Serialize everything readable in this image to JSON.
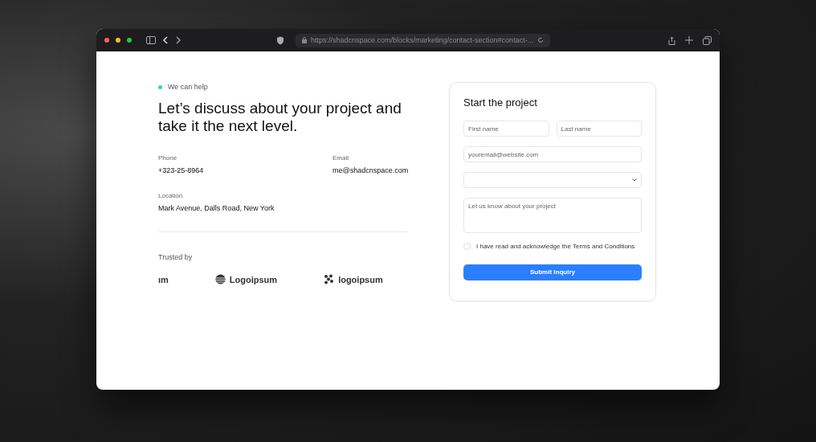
{
  "browser": {
    "url": "https://shadcnspace.com/blocks/marketing/contact-section#contact-..."
  },
  "badge": {
    "label": "We can help",
    "color": "#2dd4bf"
  },
  "heading": "Let’s discuss about your project and take it the next level.",
  "contacts": [
    {
      "label": "Phone",
      "value": "+323-25-8964"
    },
    {
      "label": "Email",
      "value": "me@shadcnspace.com"
    },
    {
      "label": "Location",
      "value": "Mark Avenue, Dalls Road, New York"
    }
  ],
  "trusted": {
    "title": "Trusted by",
    "logos": [
      {
        "kind": "cut",
        "name": "ım"
      },
      {
        "kind": "globe",
        "name": "Logoipsum"
      },
      {
        "kind": "dots",
        "name": "logoipsum"
      }
    ]
  },
  "form": {
    "title": "Start the project",
    "first_name": {
      "placeholder": "First name"
    },
    "last_name": {
      "placeholder": "Last name"
    },
    "email": {
      "placeholder": "youremail@website.com"
    },
    "message": {
      "placeholder": "Let us know about your project"
    },
    "consent": {
      "label": "I have read and acknowledge the Terms and Conditions",
      "checked": false
    },
    "submit": "Submit Inquiry"
  }
}
